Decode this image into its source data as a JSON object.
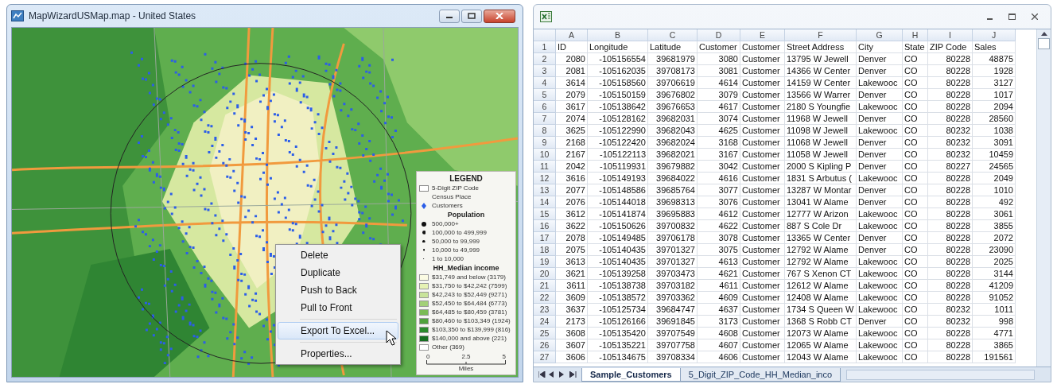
{
  "map_window": {
    "title": "MapWizardUSMap.map - United States",
    "legend": {
      "title": "LEGEND",
      "entries": [
        {
          "kind": "outline",
          "label": "5-Digit ZIP Code"
        },
        {
          "kind": "plain",
          "label": "Census Place"
        },
        {
          "kind": "pin",
          "label": "Customers"
        },
        {
          "kind": "heading",
          "label": "Population"
        },
        {
          "kind": "dot",
          "label": "500,000+"
        },
        {
          "kind": "dot",
          "label": "100,000 to 499,999"
        },
        {
          "kind": "dot",
          "label": "50,000 to 99,999"
        },
        {
          "kind": "dot",
          "label": "10,000 to 49,999"
        },
        {
          "kind": "dot",
          "label": "1 to 10,000"
        },
        {
          "kind": "heading",
          "label": "HH_Median income"
        },
        {
          "kind": "swatch",
          "label": "$31,749 and below (3179)",
          "color": "#fbfbe3"
        },
        {
          "kind": "swatch",
          "label": "$31,750 to $42,242 (7599)",
          "color": "#e6f2b4"
        },
        {
          "kind": "swatch",
          "label": "$42,243 to $52,449 (9271)",
          "color": "#c8e39a"
        },
        {
          "kind": "swatch",
          "label": "$52,450 to $64,484 (6773)",
          "color": "#a3d078"
        },
        {
          "kind": "swatch",
          "label": "$64,485 to $80,459 (3781)",
          "color": "#7bbb55"
        },
        {
          "kind": "swatch",
          "label": "$80,460 to $103,349 (1924)",
          "color": "#4fa23c"
        },
        {
          "kind": "swatch",
          "label": "$103,350 to $139,999 (816)",
          "color": "#2a8a2c"
        },
        {
          "kind": "swatch",
          "label": "$140,000 and above (221)",
          "color": "#166e20"
        },
        {
          "kind": "swatch",
          "label": "Other (369)",
          "color": "#ffffff"
        }
      ],
      "scale": {
        "ticks": [
          "0",
          "2.5",
          "5"
        ],
        "unit": "Miles"
      }
    },
    "context_menu": [
      {
        "kind": "item",
        "label": "Delete",
        "selected": false
      },
      {
        "kind": "item",
        "label": "Duplicate",
        "selected": false
      },
      {
        "kind": "item",
        "label": "Push to Back",
        "selected": false
      },
      {
        "kind": "item",
        "label": "Pull to Front",
        "selected": false
      },
      {
        "kind": "separator"
      },
      {
        "kind": "item",
        "label": "Export To Excel...",
        "selected": true
      },
      {
        "kind": "separator"
      },
      {
        "kind": "item",
        "label": "Properties...",
        "selected": false
      }
    ]
  },
  "spreadsheet": {
    "columns": [
      {
        "letter": "A",
        "kind": "number"
      },
      {
        "letter": "B",
        "kind": "number"
      },
      {
        "letter": "C",
        "kind": "number"
      },
      {
        "letter": "D",
        "kind": "number"
      },
      {
        "letter": "E",
        "kind": "text"
      },
      {
        "letter": "F",
        "kind": "text"
      },
      {
        "letter": "G",
        "kind": "text"
      },
      {
        "letter": "H",
        "kind": "text"
      },
      {
        "letter": "I",
        "kind": "number"
      },
      {
        "letter": "J",
        "kind": "number"
      }
    ],
    "rows": [
      {
        "num": "1",
        "kind": "header",
        "cells": [
          "ID",
          "Longitude",
          "Latitude",
          "Customer",
          "Customer",
          "Street Address",
          "City",
          "State",
          "ZIP Code",
          "Sales"
        ]
      },
      {
        "num": "2",
        "kind": "data",
        "cells": [
          "2080",
          "-105156554",
          "39681979",
          "3080",
          "Customer",
          "13795 W Jewell",
          "Denver",
          "CO",
          "80228",
          "48875"
        ]
      },
      {
        "num": "3",
        "kind": "data",
        "cells": [
          "2081",
          "-105162035",
          "39708173",
          "3081",
          "Customer",
          "14366 W Center",
          "Denver",
          "CO",
          "80228",
          "1928"
        ]
      },
      {
        "num": "4",
        "kind": "data",
        "cells": [
          "3614",
          "-105158560",
          "39706619",
          "4614",
          "Customer",
          "14159 W Center",
          "Lakewooc",
          "CO",
          "80228",
          "3127"
        ]
      },
      {
        "num": "5",
        "kind": "data",
        "cells": [
          "2079",
          "-105150159",
          "39676802",
          "3079",
          "Customer",
          "13566 W Warrer",
          "Denver",
          "CO",
          "80228",
          "1017"
        ]
      },
      {
        "num": "6",
        "kind": "data",
        "cells": [
          "3617",
          "-105138642",
          "39676653",
          "4617",
          "Customer",
          "2180 S Youngfie",
          "Lakewooc",
          "CO",
          "80228",
          "2094"
        ]
      },
      {
        "num": "7",
        "kind": "data",
        "cells": [
          "2074",
          "-105128162",
          "39682031",
          "3074",
          "Customer",
          "11968 W Jewell",
          "Denver",
          "CO",
          "80228",
          "28560"
        ]
      },
      {
        "num": "8",
        "kind": "data",
        "cells": [
          "3625",
          "-105122990",
          "39682043",
          "4625",
          "Customer",
          "11098 W Jewell",
          "Lakewooc",
          "CO",
          "80232",
          "1038"
        ]
      },
      {
        "num": "9",
        "kind": "data",
        "cells": [
          "2168",
          "-105122420",
          "39682024",
          "3168",
          "Customer",
          "11068 W Jewell",
          "Denver",
          "CO",
          "80232",
          "3091"
        ]
      },
      {
        "num": "10",
        "kind": "data",
        "cells": [
          "2167",
          "-105122113",
          "39682021",
          "3167",
          "Customer",
          "11058 W Jewell",
          "Denver",
          "CO",
          "80232",
          "10459"
        ]
      },
      {
        "num": "11",
        "kind": "data",
        "cells": [
          "2042",
          "-105119931",
          "39679882",
          "3042",
          "Customer",
          "2000 S Kipling P",
          "Denver",
          "CO",
          "80227",
          "24565"
        ]
      },
      {
        "num": "12",
        "kind": "data",
        "cells": [
          "3616",
          "-105149193",
          "39684022",
          "4616",
          "Customer",
          "1831 S Arbutus (",
          "Lakewooc",
          "CO",
          "80228",
          "2049"
        ]
      },
      {
        "num": "13",
        "kind": "data",
        "cells": [
          "2077",
          "-105148586",
          "39685764",
          "3077",
          "Customer",
          "13287 W Montar",
          "Denver",
          "CO",
          "80228",
          "1010"
        ]
      },
      {
        "num": "14",
        "kind": "data",
        "cells": [
          "2076",
          "-105144018",
          "39698313",
          "3076",
          "Customer",
          "13041 W Alame",
          "Denver",
          "CO",
          "80228",
          "492"
        ]
      },
      {
        "num": "15",
        "kind": "data",
        "cells": [
          "3612",
          "-105141874",
          "39695883",
          "4612",
          "Customer",
          "12777 W Arizon",
          "Lakewooc",
          "CO",
          "80228",
          "3061"
        ]
      },
      {
        "num": "16",
        "kind": "data",
        "cells": [
          "3622",
          "-105150626",
          "39700832",
          "4622",
          "Customer",
          "887 S Cole Dr",
          "Lakewooc",
          "CO",
          "80228",
          "3855"
        ]
      },
      {
        "num": "17",
        "kind": "data",
        "cells": [
          "2078",
          "-105149485",
          "39706178",
          "3078",
          "Customer",
          "13365 W Center",
          "Denver",
          "CO",
          "80228",
          "2072"
        ]
      },
      {
        "num": "18",
        "kind": "data",
        "cells": [
          "2075",
          "-105140435",
          "39701327",
          "3075",
          "Customer",
          "12792 W Alame",
          "Denver",
          "CO",
          "80228",
          "23090"
        ]
      },
      {
        "num": "19",
        "kind": "data",
        "cells": [
          "3613",
          "-105140435",
          "39701327",
          "4613",
          "Customer",
          "12792 W Alame",
          "Lakewooc",
          "CO",
          "80228",
          "2025"
        ]
      },
      {
        "num": "20",
        "kind": "data",
        "cells": [
          "3621",
          "-105139258",
          "39703473",
          "4621",
          "Customer",
          "767 S Xenon CT",
          "Lakewooc",
          "CO",
          "80228",
          "3144"
        ]
      },
      {
        "num": "21",
        "kind": "data",
        "cells": [
          "3611",
          "-105138738",
          "39703182",
          "4611",
          "Customer",
          "12612 W Alame",
          "Lakewooc",
          "CO",
          "80228",
          "41209"
        ]
      },
      {
        "num": "22",
        "kind": "data",
        "cells": [
          "3609",
          "-105138572",
          "39703362",
          "4609",
          "Customer",
          "12408 W Alame",
          "Lakewooc",
          "CO",
          "80228",
          "91052"
        ]
      },
      {
        "num": "23",
        "kind": "data",
        "cells": [
          "3637",
          "-105125734",
          "39684747",
          "4637",
          "Customer",
          "1734 S Queen W",
          "Lakewooc",
          "CO",
          "80232",
          "1011"
        ]
      },
      {
        "num": "24",
        "kind": "data",
        "cells": [
          "2173",
          "-105126166",
          "39691845",
          "3173",
          "Customer",
          "1368 S Robb CT",
          "Denver",
          "CO",
          "80232",
          "998"
        ]
      },
      {
        "num": "25",
        "kind": "data",
        "cells": [
          "3608",
          "-105135420",
          "39707549",
          "4608",
          "Customer",
          "12073 W Alame",
          "Lakewooc",
          "CO",
          "80228",
          "4771"
        ]
      },
      {
        "num": "26",
        "kind": "data",
        "cells": [
          "3607",
          "-105135221",
          "39707758",
          "4607",
          "Customer",
          "12065 W Alame",
          "Lakewooc",
          "CO",
          "80228",
          "3865"
        ]
      },
      {
        "num": "27",
        "kind": "data",
        "cells": [
          "3606",
          "-105134675",
          "39708334",
          "4606",
          "Customer",
          "12043 W Alame",
          "Lakewooc",
          "CO",
          "80228",
          "191561"
        ]
      }
    ],
    "sheet_tabs": [
      {
        "label": "Sample_Customers",
        "selected": true
      },
      {
        "label": "5_Digit_ZIP_Code_HH_Median_inco",
        "selected": false
      }
    ]
  }
}
